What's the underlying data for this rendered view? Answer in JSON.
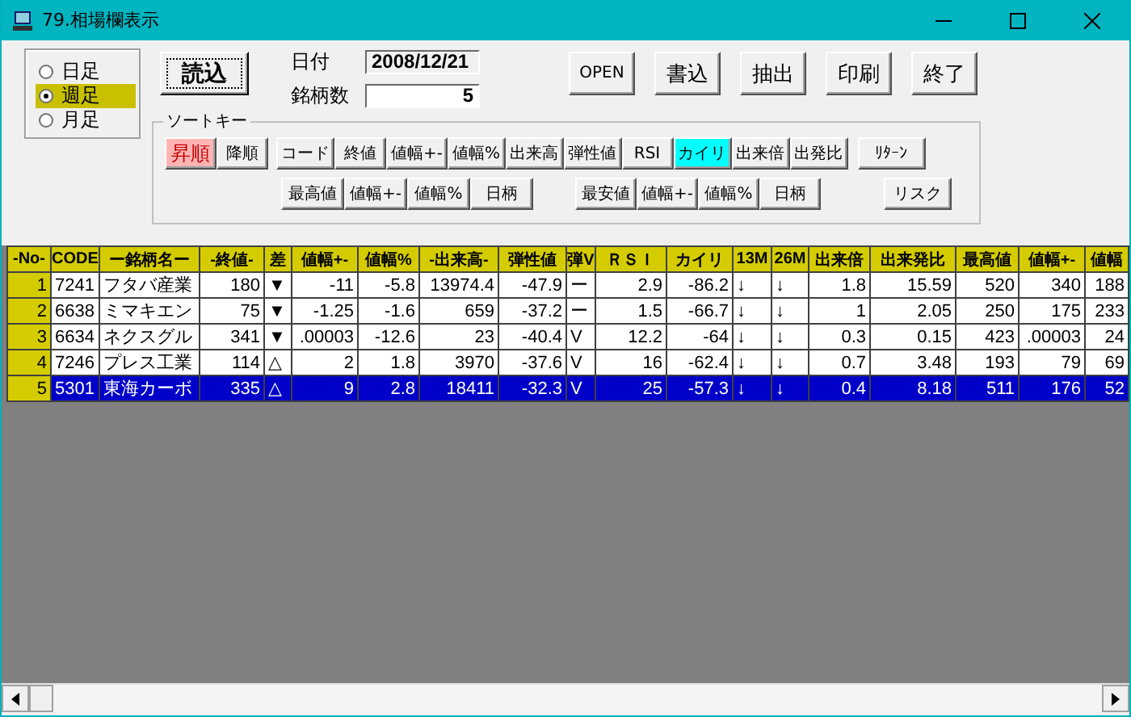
{
  "window": {
    "title": "79.相場欄表示"
  },
  "period_options": [
    {
      "label": "日足",
      "selected": false
    },
    {
      "label": "週足",
      "selected": true
    },
    {
      "label": "月足",
      "selected": false
    }
  ],
  "load_button": "読込",
  "date": {
    "label": "日付",
    "value": "2008/12/21"
  },
  "stock_count": {
    "label": "銘柄数",
    "value": "5"
  },
  "action_buttons": [
    "OPEN",
    "書込",
    "抽出",
    "印刷",
    "終了"
  ],
  "sort_key": {
    "title": "ソートキー",
    "order": [
      {
        "label": "昇順",
        "selected": true
      },
      {
        "label": "降順",
        "selected": false
      }
    ],
    "keys_row_1": [
      {
        "label": "コード",
        "selected": false
      },
      {
        "label": "終値",
        "selected": false
      },
      {
        "label": "値幅+-",
        "selected": false
      },
      {
        "label": "値幅%",
        "selected": false
      },
      {
        "label": "出来高",
        "selected": false
      },
      {
        "label": "弾性値",
        "selected": false
      },
      {
        "label": "RSI",
        "selected": false
      },
      {
        "label": "カイリ",
        "selected": true
      },
      {
        "label": "出来倍",
        "selected": false
      },
      {
        "label": "出発比",
        "selected": false
      }
    ],
    "keys_high": [
      {
        "label": "最高値",
        "selected": false
      },
      {
        "label": "値幅+-",
        "selected": false
      },
      {
        "label": "値幅%",
        "selected": false
      },
      {
        "label": "日柄",
        "selected": false
      }
    ],
    "keys_low": [
      {
        "label": "最安値",
        "selected": false
      },
      {
        "label": "値幅+-",
        "selected": false
      },
      {
        "label": "値幅%",
        "selected": false
      },
      {
        "label": "日柄",
        "selected": false
      }
    ],
    "side_buttons": [
      "ﾘﾀｰﾝ",
      "リスク"
    ]
  },
  "table": {
    "columns": [
      "-No-",
      "CODE",
      "ー銘柄名ー",
      "-終値-",
      "差",
      "値幅+-",
      "値幅%",
      "-出来高-",
      "弾性値",
      "弾V",
      "ＲＳＩ",
      "カイリ",
      "13M",
      "26M",
      "出来倍",
      "出来発比",
      "最高値",
      "値幅+-",
      "値幅"
    ],
    "rows": [
      {
        "selected": false,
        "cells": [
          "1",
          "7241",
          "フタバ産業",
          "180",
          "▼",
          "-11",
          "-5.8",
          "13974.4",
          "-47.9",
          "ー",
          "2.9",
          "-86.2",
          "↓",
          "↓",
          "1.8",
          "15.59",
          "520",
          "340",
          "188"
        ]
      },
      {
        "selected": false,
        "cells": [
          "2",
          "6638",
          "ミマキエン",
          "75",
          "▼",
          "-1.25",
          "-1.6",
          "659",
          "-37.2",
          "ー",
          "1.5",
          "-66.7",
          "↓",
          "↓",
          "1",
          "2.05",
          "250",
          "175",
          "233"
        ]
      },
      {
        "selected": false,
        "cells": [
          "3",
          "6634",
          "ネクスグル",
          "341",
          "▼",
          ".00003",
          "-12.6",
          "23",
          "-40.4",
          "V",
          "12.2",
          "-64",
          "↓",
          "↓",
          "0.3",
          "0.15",
          "423",
          ".00003",
          "24"
        ]
      },
      {
        "selected": false,
        "cells": [
          "4",
          "7246",
          "プレス工業",
          "114",
          "△",
          "2",
          "1.8",
          "3970",
          "-37.6",
          "V",
          "16",
          "-62.4",
          "↓",
          "↓",
          "0.7",
          "3.48",
          "193",
          "79",
          "69"
        ]
      },
      {
        "selected": true,
        "cells": [
          "5",
          "5301",
          "東海カーボ",
          "335",
          "△",
          "9",
          "2.8",
          "18411",
          "-32.3",
          "V",
          "25",
          "-57.3",
          "↓",
          "↓",
          "0.4",
          "8.18",
          "511",
          "176",
          "52"
        ]
      }
    ]
  }
}
